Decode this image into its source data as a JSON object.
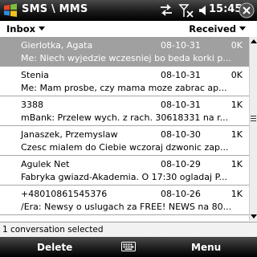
{
  "titlebar": {
    "title": "SMS \\ MMS",
    "time": "15:45",
    "icons": [
      "windows-start-icon",
      "sync-icon",
      "signal-off-icon",
      "volume-icon",
      "ok-close-icon"
    ]
  },
  "filter": {
    "folder": "Inbox",
    "sort": "Received"
  },
  "messages": [
    {
      "sender": "Gierlotka, Agata",
      "date": "08-10-31",
      "size": "0K",
      "preview": "Me: Niech wyjedzie wczesniej bo beda korki p...",
      "selected": true
    },
    {
      "sender": "Stenia",
      "date": "08-10-31",
      "size": "0K",
      "preview": "Me: Mam prosbe, czy mama moze zabrac ap...",
      "selected": false
    },
    {
      "sender": "3388",
      "date": "08-10-31",
      "size": "1K",
      "preview": "mBank: Przelew wych. z rach. 30618331 na r...",
      "selected": false
    },
    {
      "sender": "Janaszek, Przemyslaw",
      "date": "08-10-30",
      "size": "1K",
      "preview": "Czesc mialem do Ciebie wczoraj dzwonic zap...",
      "selected": false
    },
    {
      "sender": "Agulek Net",
      "date": "08-10-29",
      "size": "1K",
      "preview": "Fabryka gwiazd-Akademia. O 17:30 ogladaj P...",
      "selected": false
    },
    {
      "sender": "+48010861545376",
      "date": "08-10-26",
      "size": "1K",
      "preview": "/Era: Newsy o uslugach za FREE! NEWS na 80...",
      "selected": false
    }
  ],
  "status": {
    "text": "1 conversation selected"
  },
  "softkeys": {
    "left": "Delete",
    "right": "Menu"
  },
  "colors": {
    "bar": "#1a1a1a",
    "selection": "#a0a0a0"
  }
}
